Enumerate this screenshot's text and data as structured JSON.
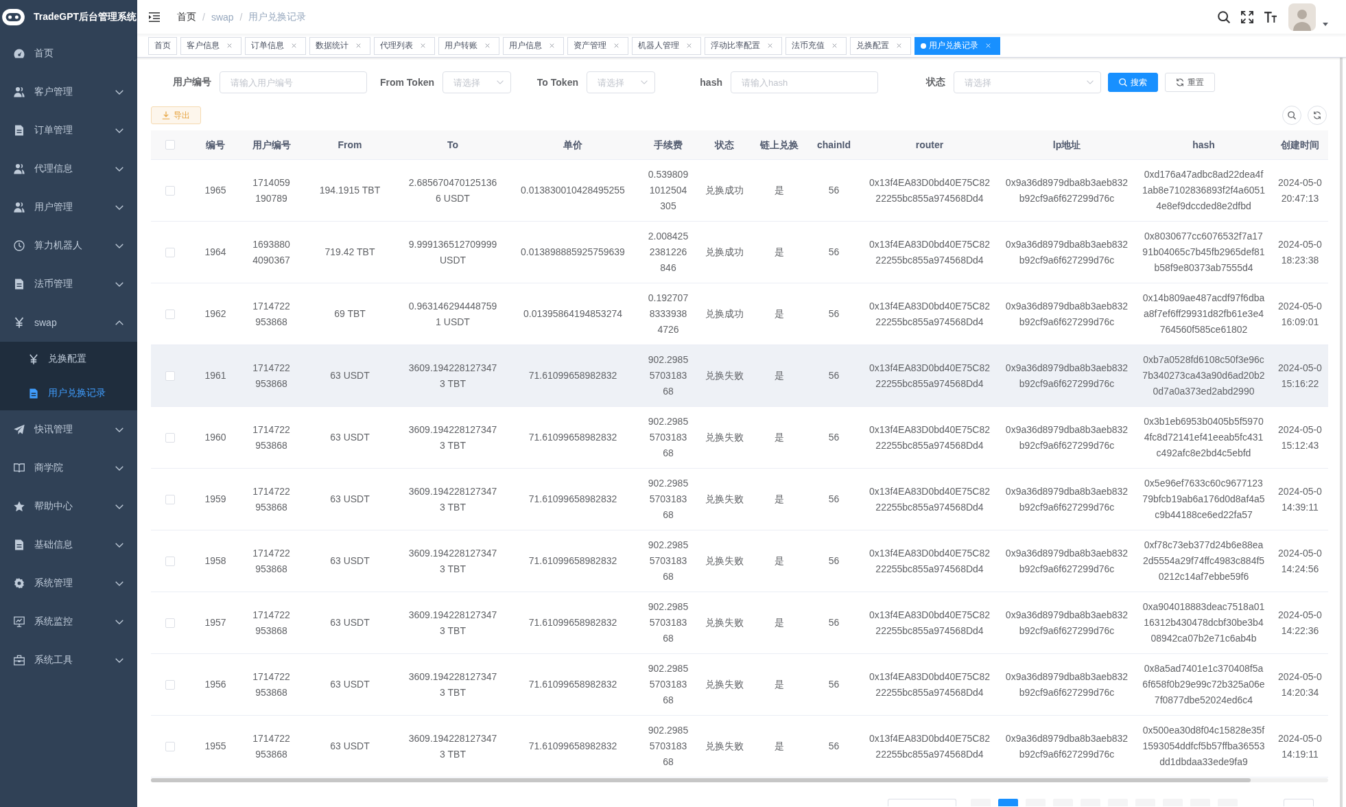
{
  "sidebar": {
    "title": "TradeGPT后台管理系统",
    "items": [
      {
        "label": "首页",
        "kind": "link",
        "selected": false
      },
      {
        "label": "客户管理",
        "kind": "menu",
        "expanded": false
      },
      {
        "label": "订单管理",
        "kind": "menu",
        "expanded": false
      },
      {
        "label": "代理信息",
        "kind": "menu",
        "expanded": false
      },
      {
        "label": "用户管理",
        "kind": "menu",
        "expanded": false
      },
      {
        "label": "算力机器人",
        "kind": "menu",
        "expanded": false
      },
      {
        "label": "法币管理",
        "kind": "menu",
        "expanded": false
      },
      {
        "label": "swap",
        "kind": "menu",
        "expanded": true,
        "children": [
          {
            "label": "兑换配置",
            "selected": false
          },
          {
            "label": "用户兑换记录",
            "selected": true
          }
        ]
      },
      {
        "label": "快讯管理",
        "kind": "menu",
        "expanded": false
      },
      {
        "label": "商学院",
        "kind": "menu",
        "expanded": false
      },
      {
        "label": "帮助中心",
        "kind": "menu",
        "expanded": false
      },
      {
        "label": "基础信息",
        "kind": "menu",
        "expanded": false
      },
      {
        "label": "系统管理",
        "kind": "menu",
        "expanded": false
      },
      {
        "label": "系统监控",
        "kind": "menu",
        "expanded": false
      },
      {
        "label": "系统工具",
        "kind": "menu",
        "expanded": false
      }
    ]
  },
  "breadcrumb": [
    {
      "kind": "link",
      "text": "首页"
    },
    {
      "kind": "separator",
      "text": "/"
    },
    {
      "kind": "text",
      "text": "swap"
    },
    {
      "kind": "separator",
      "text": "/"
    },
    {
      "kind": "text",
      "text": "用户兑换记录"
    }
  ],
  "tags": [
    {
      "label": "首页",
      "closable": false,
      "selected": false
    },
    {
      "label": "客户信息",
      "closable": true,
      "selected": false
    },
    {
      "label": "订单信息",
      "closable": true,
      "selected": false
    },
    {
      "label": "数据统计",
      "closable": true,
      "selected": false
    },
    {
      "label": "代理列表",
      "closable": true,
      "selected": false
    },
    {
      "label": "用户转账",
      "closable": true,
      "selected": false
    },
    {
      "label": "用户信息",
      "closable": true,
      "selected": false
    },
    {
      "label": "资产管理",
      "closable": true,
      "selected": false
    },
    {
      "label": "机器人管理",
      "closable": true,
      "selected": false
    },
    {
      "label": "浮动比率配置",
      "closable": true,
      "selected": false
    },
    {
      "label": "法币充值",
      "closable": true,
      "selected": false
    },
    {
      "label": "兑换配置",
      "closable": true,
      "selected": false
    },
    {
      "label": "用户兑换记录",
      "closable": true,
      "selected": true
    }
  ],
  "filters": [
    {
      "label": "用户编号",
      "kind": "input",
      "placeholder": "请输入用户编号"
    },
    {
      "label": "From Token",
      "kind": "select",
      "placeholder": "请选择"
    },
    {
      "label": "To Token",
      "kind": "select",
      "placeholder": "请选择"
    },
    {
      "label": "hash",
      "kind": "input",
      "placeholder": "请输入hash"
    },
    {
      "label": "状态",
      "kind": "select",
      "placeholder": "请选择"
    }
  ],
  "search_button": "搜索",
  "reset_button": "重置",
  "export_button": "导出",
  "table": {
    "all_selected": false,
    "columns": [
      "编号",
      "用户编号",
      "From",
      "To",
      "单价",
      "手续费",
      "状态",
      "链上兑换",
      "chainId",
      "router",
      "lp地址",
      "hash",
      "创建时间"
    ],
    "rows": [
      {
        "selected": false,
        "hovered": false,
        "cells": [
          "1965",
          "1714059190789",
          "194.1915 TBT",
          "2.6856704701251366 USDT",
          "0.013830010428495255",
          "0.5398091012504305",
          "兑换成功",
          "是",
          "56",
          "0x13f4EA83D0bd40E75C8222255bc855a974568Dd4",
          "0x9a36d8979dba8b3aeb832b92cf9a6f627299d76c",
          "0xd176a47adbc8ad22dea4f1ab8e7102836893f2f4a60514e8ef9dccded8e2dfbd",
          "2024-05-0 20:47:13"
        ]
      },
      {
        "selected": false,
        "hovered": false,
        "cells": [
          "1964",
          "16938804090367",
          "719.42 TBT",
          "9.999136512709999 USDT",
          "0.013898885925759639",
          "2.0084252381226846",
          "兑换成功",
          "是",
          "56",
          "0x13f4EA83D0bd40E75C8222255bc855a974568Dd4",
          "0x9a36d8979dba8b3aeb832b92cf9a6f627299d76c",
          "0x8030677cc6076532f7a1791b04065c7b45fb2965def81b58f9e80373ab7555d4",
          "2024-05-0 18:23:38"
        ]
      },
      {
        "selected": false,
        "hovered": false,
        "cells": [
          "1962",
          "1714722953868",
          "69 TBT",
          "0.9631462944487591 USDT",
          "0.01395864194853274",
          "0.19270783339384726",
          "兑换成功",
          "是",
          "56",
          "0x13f4EA83D0bd40E75C8222255bc855a974568Dd4",
          "0x9a36d8979dba8b3aeb832b92cf9a6f627299d76c",
          "0x14b809ae487acdf97f6dbaa8f7ef6ff29931d82fb61e3e4764560f585ce61802",
          "2024-05-0 16:09:01"
        ]
      },
      {
        "selected": false,
        "hovered": true,
        "cells": [
          "1961",
          "1714722953868",
          "63 USDT",
          "3609.1942281273473 TBT",
          "71.61099658982832",
          "902.2985570318368",
          "兑换失败",
          "是",
          "56",
          "0x13f4EA83D0bd40E75C8222255bc855a974568Dd4",
          "0x9a36d8979dba8b3aeb832b92cf9a6f627299d76c",
          "0xb7a0528fd6108c50f3e96c7b340273ca43a90d6ad20b20d7a0a373ed2abd2990",
          "2024-05-0 15:16:22"
        ]
      },
      {
        "selected": false,
        "hovered": false,
        "cells": [
          "1960",
          "1714722953868",
          "63 USDT",
          "3609.1942281273473 TBT",
          "71.61099658982832",
          "902.2985570318368",
          "兑换失败",
          "是",
          "56",
          "0x13f4EA83D0bd40E75C8222255bc855a974568Dd4",
          "0x9a36d8979dba8b3aeb832b92cf9a6f627299d76c",
          "0x3b1eb6953b0405b5f59704fc8d72141ef41eeab5fc431c492afc8e2bd4c5ebfd",
          "2024-05-0 15:12:43"
        ]
      },
      {
        "selected": false,
        "hovered": false,
        "cells": [
          "1959",
          "1714722953868",
          "63 USDT",
          "3609.1942281273473 TBT",
          "71.61099658982832",
          "902.2985570318368",
          "兑换失败",
          "是",
          "56",
          "0x13f4EA83D0bd40E75C8222255bc855a974568Dd4",
          "0x9a36d8979dba8b3aeb832b92cf9a6f627299d76c",
          "0x5e96ef7633c60c967712379bfcb19ab6a176d0d8af4a5c9b44188ce6ed22fa57",
          "2024-05-0 14:39:11"
        ]
      },
      {
        "selected": false,
        "hovered": false,
        "cells": [
          "1958",
          "1714722953868",
          "63 USDT",
          "3609.1942281273473 TBT",
          "71.61099658982832",
          "902.2985570318368",
          "兑换失败",
          "是",
          "56",
          "0x13f4EA83D0bd40E75C8222255bc855a974568Dd4",
          "0x9a36d8979dba8b3aeb832b92cf9a6f627299d76c",
          "0xf78c73eb377d24b6e88ea2d5554a29f74ffc4983c884f50212c14af7ebbe59f6",
          "2024-05-0 14:24:56"
        ]
      },
      {
        "selected": false,
        "hovered": false,
        "cells": [
          "1957",
          "1714722953868",
          "63 USDT",
          "3609.1942281273473 TBT",
          "71.61099658982832",
          "902.2985570318368",
          "兑换失败",
          "是",
          "56",
          "0x13f4EA83D0bd40E75C8222255bc855a974568Dd4",
          "0x9a36d8979dba8b3aeb832b92cf9a6f627299d76c",
          "0xa904018883deac7518a0116312b430478dcbf30be3b408942ca07b2e71c6ab4b",
          "2024-05-0 14:22:36"
        ]
      },
      {
        "selected": false,
        "hovered": false,
        "cells": [
          "1956",
          "1714722953868",
          "63 USDT",
          "3609.1942281273473 TBT",
          "71.61099658982832",
          "902.2985570318368",
          "兑换失败",
          "是",
          "56",
          "0x13f4EA83D0bd40E75C8222255bc855a974568Dd4",
          "0x9a36d8979dba8b3aeb832b92cf9a6f627299d76c",
          "0x8a5ad7401e1c370408f5a6f658f0b29e99c72b325a06e7f0877dbe52024ed6c4",
          "2024-05-0 14:20:34"
        ]
      },
      {
        "selected": false,
        "hovered": false,
        "cells": [
          "1955",
          "1714722953868",
          "63 USDT",
          "3609.1942281273473 TBT",
          "71.61099658982832",
          "902.2985570318368",
          "兑换失败",
          "是",
          "56",
          "0x13f4EA83D0bd40E75C8222255bc855a974568Dd4",
          "0x9a36d8979dba8b3aeb832b92cf9a6f627299d76c",
          "0x500ea30d8f04c15828e35f1593054ddfcf5b57ffba36553dd1dbdaa33ede9fa9",
          "2024-05-0 14:19:11"
        ]
      }
    ]
  },
  "pagination": {
    "pages": [
      {
        "selected": true
      },
      {
        "selected": false
      },
      {
        "selected": false
      },
      {
        "selected": false
      },
      {
        "selected": false
      },
      {
        "selected": false
      },
      {
        "selected": false
      },
      {
        "selected": false
      }
    ]
  }
}
